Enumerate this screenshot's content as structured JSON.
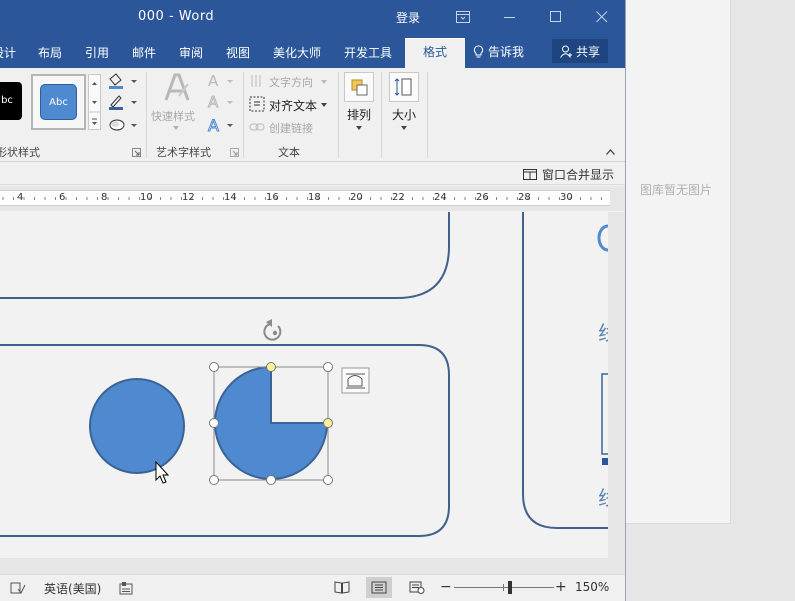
{
  "window": {
    "title": "000  -  Word",
    "login_label": "登录"
  },
  "tabs": [
    {
      "label": "设计"
    },
    {
      "label": "布局"
    },
    {
      "label": "引用"
    },
    {
      "label": "邮件"
    },
    {
      "label": "审阅"
    },
    {
      "label": "视图"
    },
    {
      "label": "美化大师"
    },
    {
      "label": "开发工具"
    }
  ],
  "active_tab": "格式",
  "tell_me": "告诉我",
  "share": "共享",
  "ribbon": {
    "shape_styles": {
      "label": "形状样式",
      "swatch_dark": "bc",
      "swatch_blue": "Abc"
    },
    "wordart_styles": {
      "label": "艺术字样式",
      "quick_styles": "快速样式"
    },
    "text": {
      "label": "文本",
      "text_direction": "文字方向",
      "align_text": "对齐文本",
      "create_link": "创建链接"
    },
    "arrange": {
      "label": "排列"
    },
    "size": {
      "label": "大小"
    }
  },
  "notice_bar": {
    "merge_label": "窗口合并显示"
  },
  "ruler": {
    "numbers": [
      "4",
      "6",
      "8",
      "10",
      "12",
      "14",
      "16",
      "18",
      "20",
      "22",
      "24",
      "26",
      "28",
      "30"
    ]
  },
  "status": {
    "language": "英语(美国)",
    "zoom": "150%",
    "zoom_slider_fraction": 0.56
  },
  "side_panel": {
    "no_image_text": "图库暂无图片"
  },
  "page_text": {
    "partial_char_1": "线",
    "partial_char_2": "线"
  },
  "colors": {
    "titlebar": "#2b579a",
    "shape_fill": "#4f89cf",
    "shape_stroke": "#3a6496",
    "rounded_frame_stroke": "#41618c",
    "handle_yellow": "#fff09a"
  }
}
